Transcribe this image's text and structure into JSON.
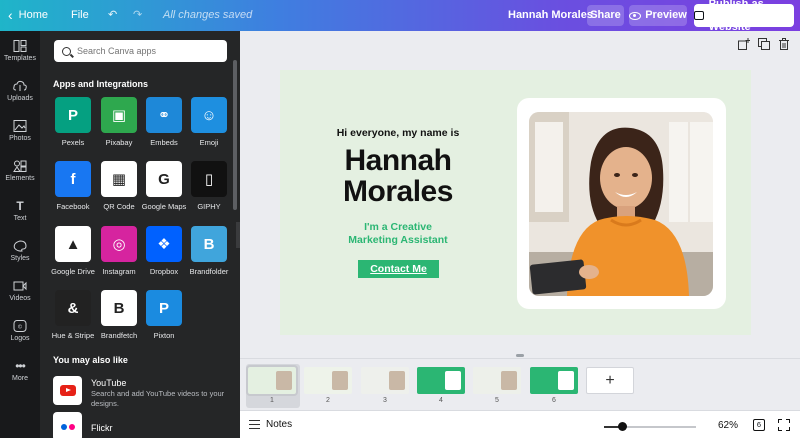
{
  "topbar": {
    "home_label": "Home",
    "file_label": "File",
    "saved_status": "All changes saved",
    "document_name": "Hannah Morales",
    "share_label": "Share",
    "preview_label": "Preview",
    "publish_label": "Publish as Website"
  },
  "rail": {
    "items": [
      {
        "label": "Templates",
        "icon": "templates-icon"
      },
      {
        "label": "Uploads",
        "icon": "upload-icon"
      },
      {
        "label": "Photos",
        "icon": "photos-icon"
      },
      {
        "label": "Elements",
        "icon": "elements-icon"
      },
      {
        "label": "Text",
        "icon": "text-icon"
      },
      {
        "label": "Styles",
        "icon": "palette-icon"
      },
      {
        "label": "Videos",
        "icon": "video-icon"
      },
      {
        "label": "Logos",
        "icon": "logo-icon"
      },
      {
        "label": "More",
        "icon": "more-icon"
      }
    ]
  },
  "panel": {
    "search_placeholder": "Search Canva apps",
    "apps_title": "Apps and Integrations",
    "apps": [
      {
        "label": "Pexels",
        "color": "#05a081",
        "glyph": "P"
      },
      {
        "label": "Pixabay",
        "color": "#2ea84e",
        "glyph": "▣"
      },
      {
        "label": "Embeds",
        "color": "#1e88d8",
        "glyph": "⚭"
      },
      {
        "label": "Emoji",
        "color": "#1e8fe0",
        "glyph": "☺"
      },
      {
        "label": "Facebook",
        "color": "#1877f2",
        "glyph": "f"
      },
      {
        "label": "QR Code",
        "color": "#ffffff",
        "glyph": "▦"
      },
      {
        "label": "Google Maps",
        "color": "#ffffff",
        "glyph": "G"
      },
      {
        "label": "GIPHY",
        "color": "#111111",
        "glyph": "▯"
      },
      {
        "label": "Google Drive",
        "color": "#ffffff",
        "glyph": "▲"
      },
      {
        "label": "Instagram",
        "color": "#d6249f",
        "glyph": "◎"
      },
      {
        "label": "Dropbox",
        "color": "#0061ff",
        "glyph": "❖"
      },
      {
        "label": "Brandfolder",
        "color": "#40a5dc",
        "glyph": "B"
      },
      {
        "label": "Hue & Stripe",
        "color": "#222222",
        "glyph": "&"
      },
      {
        "label": "Brandfetch",
        "color": "#ffffff",
        "glyph": "B"
      },
      {
        "label": "Pixton",
        "color": "#1b8be0",
        "glyph": "P"
      }
    ],
    "also_like_title": "You may also like",
    "youtube": {
      "name": "YouTube",
      "desc": "Search and add YouTube videos to your designs."
    },
    "flickr": {
      "name": "Flickr"
    }
  },
  "slide": {
    "greeting": "Hi everyone, my name is",
    "name_line1": "Hannah",
    "name_line2": "Morales",
    "role_line1": "I'm a Creative",
    "role_line2": "Marketing Assistant",
    "cta": "Contact Me",
    "accent": "#2bb673",
    "background": "#e4f0e1"
  },
  "thumbnails": {
    "pages": [
      "1",
      "2",
      "3",
      "4",
      "5",
      "6"
    ],
    "selected": "1",
    "add_label": "+"
  },
  "bottombar": {
    "notes_label": "Notes",
    "zoom": "62%",
    "zoom_fraction": 0.2,
    "page_count": "6"
  }
}
